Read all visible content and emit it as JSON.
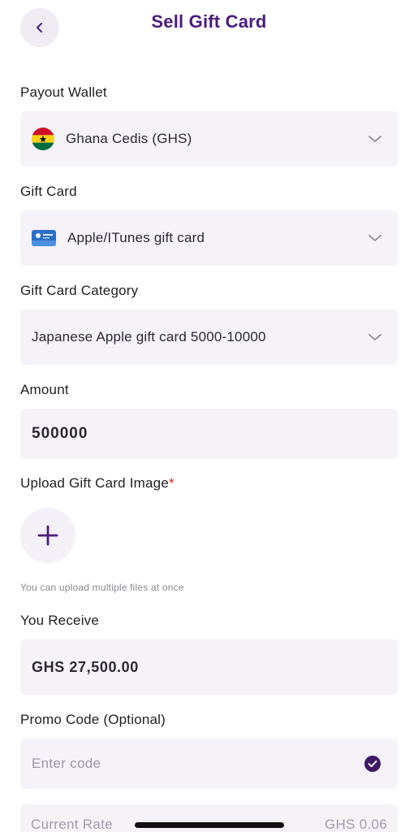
{
  "header": {
    "title": "Sell Gift Card",
    "back_icon": "chevron-left-icon"
  },
  "payout_wallet": {
    "label": "Payout Wallet",
    "value": "Ghana Cedis (GHS)",
    "flag_icon": "ghana-flag-icon"
  },
  "gift_card": {
    "label": "Gift Card",
    "value": "Apple/ITunes gift card",
    "card_icon": "apple-gift-card-icon"
  },
  "gift_card_category": {
    "label": "Gift Card Category",
    "value": "Japanese Apple gift card 5000-10000"
  },
  "amount": {
    "label": "Amount",
    "value": "500000"
  },
  "upload": {
    "label": "Upload Gift Card Image",
    "required_mark": "*",
    "hint": "You can upload multiple files at once",
    "icon": "plus-icon"
  },
  "you_receive": {
    "label": "You Receive",
    "value": "GHS 27,500.00"
  },
  "promo_code": {
    "label": "Promo Code (Optional)",
    "placeholder": "Enter code",
    "status_icon": "check-circle-icon"
  },
  "current_rate": {
    "label": "Current Rate",
    "value": "GHS 0.06"
  },
  "colors": {
    "brand": "#4a1d7a",
    "field_bg": "#f5f2f8",
    "required": "#e02020"
  }
}
